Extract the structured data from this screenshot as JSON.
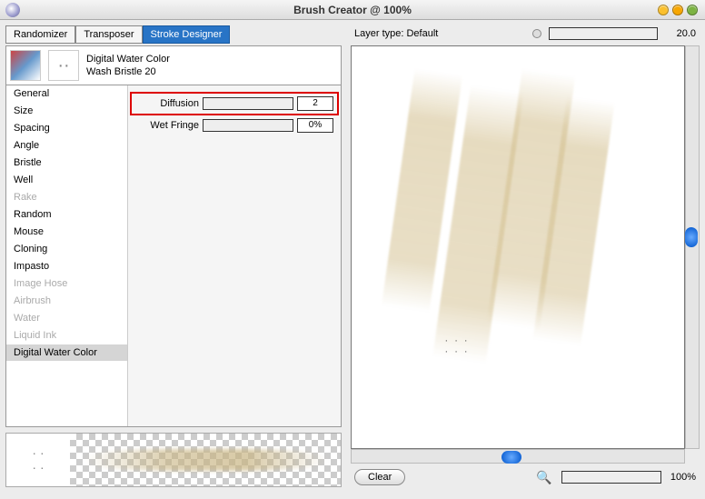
{
  "window": {
    "title": "Brush Creator @ 100%"
  },
  "tabs": {
    "randomizer": "Randomizer",
    "transposer": "Transposer",
    "designer": "Stroke Designer"
  },
  "brush": {
    "category": "Digital Water Color",
    "variant": "Wash Bristle 20"
  },
  "categories": [
    {
      "label": "General",
      "enabled": true,
      "selected": false
    },
    {
      "label": "Size",
      "enabled": true,
      "selected": false
    },
    {
      "label": "Spacing",
      "enabled": true,
      "selected": false
    },
    {
      "label": "Angle",
      "enabled": true,
      "selected": false
    },
    {
      "label": "Bristle",
      "enabled": true,
      "selected": false
    },
    {
      "label": "Well",
      "enabled": true,
      "selected": false
    },
    {
      "label": "Rake",
      "enabled": false,
      "selected": false
    },
    {
      "label": "Random",
      "enabled": true,
      "selected": false
    },
    {
      "label": "Mouse",
      "enabled": true,
      "selected": false
    },
    {
      "label": "Cloning",
      "enabled": true,
      "selected": false
    },
    {
      "label": "Impasto",
      "enabled": true,
      "selected": false
    },
    {
      "label": "Image Hose",
      "enabled": false,
      "selected": false
    },
    {
      "label": "Airbrush",
      "enabled": false,
      "selected": false
    },
    {
      "label": "Water",
      "enabled": false,
      "selected": false
    },
    {
      "label": "Liquid Ink",
      "enabled": false,
      "selected": false
    },
    {
      "label": "Digital Water Color",
      "enabled": true,
      "selected": true
    }
  ],
  "controls": {
    "diffusion": {
      "label": "Diffusion",
      "value": "2",
      "highlight": true
    },
    "wetfringe": {
      "label": "Wet Fringe",
      "value": "0%",
      "highlight": false
    }
  },
  "layer": {
    "label": "Layer type: Default",
    "size": "20.0"
  },
  "zoom": {
    "value": "100%"
  },
  "buttons": {
    "clear": "Clear"
  }
}
